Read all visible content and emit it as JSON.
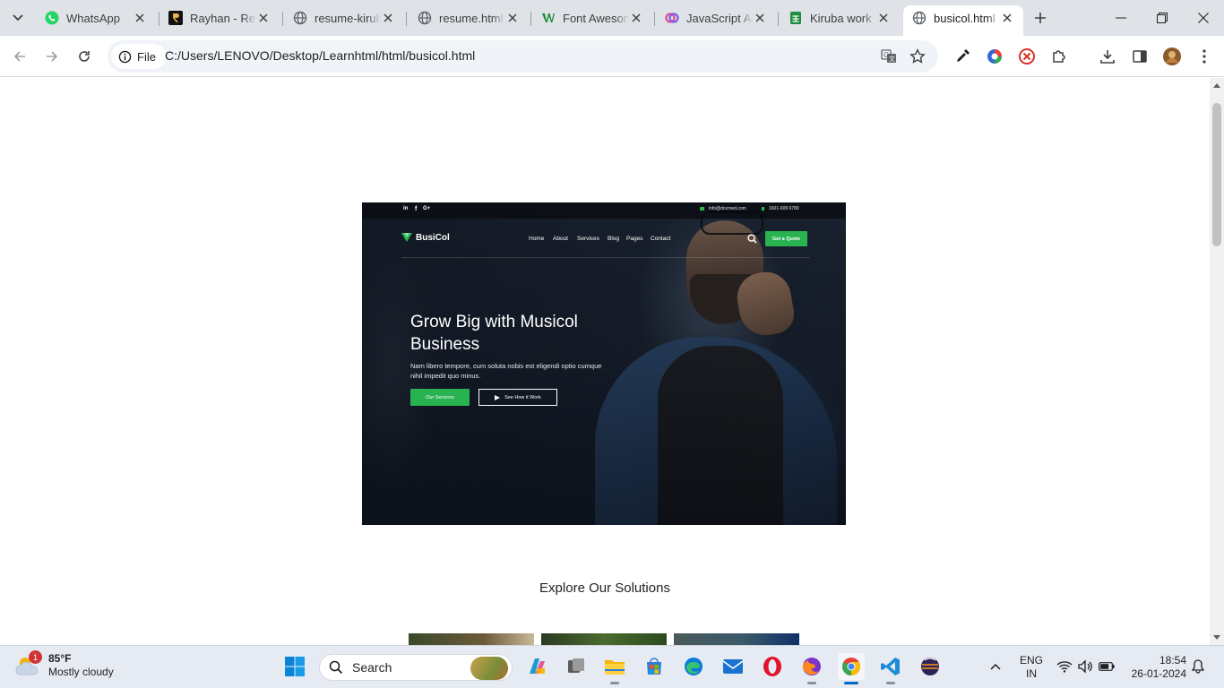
{
  "browser": {
    "tabs": [
      {
        "title": "WhatsApp",
        "icon": "whatsapp-icon"
      },
      {
        "title": "Rayhan - Resume",
        "icon": "rayhan-icon"
      },
      {
        "title": "resume-kiruba",
        "icon": "globe-icon"
      },
      {
        "title": "resume.html",
        "icon": "globe-icon"
      },
      {
        "title": "Font Awesome",
        "icon": "font-awesome-icon"
      },
      {
        "title": "JavaScript Arrays",
        "icon": "javascript-icon"
      },
      {
        "title": "Kiruba work",
        "icon": "sheets-icon"
      },
      {
        "title": "busicol.html",
        "icon": "globe-icon",
        "active": true
      }
    ],
    "address": {
      "scheme_label": "File",
      "url": "C:/Users/LENOVO/Desktop/Learnhtml/html/busicol.html"
    }
  },
  "page": {
    "topbar": {
      "social": [
        "in",
        "f",
        "G+"
      ],
      "email": "info@docmed.com",
      "phone": "1601-609 6780"
    },
    "logo": "BusiCol",
    "nav": [
      "Home",
      "About",
      "Services",
      "Blog",
      "Pages",
      "Contact"
    ],
    "quote_button": "Get a Quote",
    "hero_title": "Grow Big with Musicol Business",
    "hero_description": "Nam libero tempore, cum soluta nobis est eligendi optio cumque nihil impedit quo minus.",
    "primary_button": "Our Services",
    "secondary_button": "See How it Work",
    "section_title": "Explore Our Solutions",
    "accent_color": "#29b350"
  },
  "taskbar": {
    "weather_temp": "85°F",
    "weather_desc": "Mostly cloudy",
    "weather_badge": "1",
    "search_label": "Search",
    "lang_line1": "ENG",
    "lang_line2": "IN",
    "time": "18:54",
    "date": "26-01-2024"
  }
}
